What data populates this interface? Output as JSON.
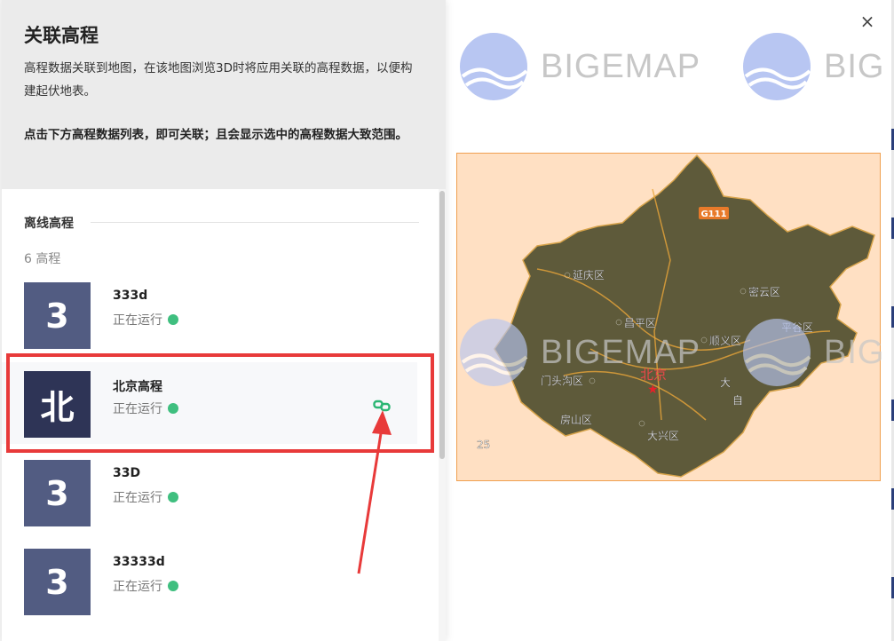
{
  "panel": {
    "title": "关联高程",
    "description": "高程数据关联到地图，在该地图浏览3D时将应用关联的高程数据，以便构建起伏地表。",
    "hint": "点击下方高程数据列表，即可关联；且会显示选中的高程数据大致范围。"
  },
  "list": {
    "section_title": "离线高程",
    "count_text": "6 高程",
    "items": [
      {
        "tile": "3",
        "name": "333d",
        "status": "正在运行"
      },
      {
        "tile": "北",
        "name": "北京高程",
        "status": "正在运行"
      },
      {
        "tile": "3",
        "name": "33D",
        "status": "正在运行"
      },
      {
        "tile": "3",
        "name": "33333d",
        "status": "正在运行"
      }
    ]
  },
  "watermark": {
    "text": "BIGEMAP",
    "text_partial": "BIG"
  },
  "close": {
    "icon": "close-icon",
    "glyph": "×"
  },
  "map": {
    "labels": {
      "highway": "G111",
      "yanqing": "延庆区",
      "miyun": "密云区",
      "changping": "昌平区",
      "shunyi": "顺义区",
      "pinggu": "平谷区",
      "mentougou": "门头沟区",
      "beijing": "北京",
      "fangshan": "房山区",
      "daxing": "大兴区",
      "da": "大",
      "zi": "自",
      "num": "25"
    }
  },
  "colors": {
    "header_bg": "#ebebeb",
    "tile_bg": "#525c82",
    "tile_bg_active": "#2e3456",
    "status_green": "#3fbf7f",
    "link_green": "#2bb673",
    "highlight_red": "#e83a3a",
    "map_bg": "#ffe0c3"
  }
}
